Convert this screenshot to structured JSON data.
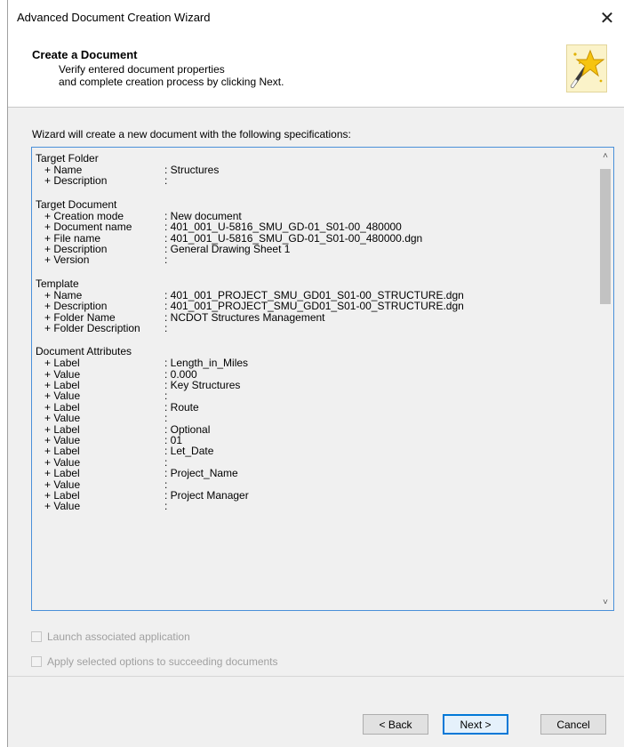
{
  "window": {
    "title": "Advanced Document Creation Wizard",
    "close_glyph": "✕"
  },
  "header": {
    "title": "Create a Document",
    "subtitle": "Verify entered document properties\nand complete creation process by clicking Next.",
    "icon": "magic-wand-star-icon"
  },
  "intro": "Wizard will create a new document with the following specifications:",
  "sections": [
    {
      "heading": "Target Folder",
      "rows": [
        {
          "k": "+ Name",
          "v": ": Structures"
        },
        {
          "k": "+ Description",
          "v": ":"
        }
      ]
    },
    {
      "heading": "Target Document",
      "rows": [
        {
          "k": "+ Creation mode",
          "v": ": New document"
        },
        {
          "k": "+ Document name",
          "v": ": 401_001_U-5816_SMU_GD-01_S01-00_480000"
        },
        {
          "k": "+ File name",
          "v": ": 401_001_U-5816_SMU_GD-01_S01-00_480000.dgn"
        },
        {
          "k": "+ Description",
          "v": ": General Drawing Sheet 1"
        },
        {
          "k": "+ Version",
          "v": ":"
        }
      ]
    },
    {
      "heading": "Template",
      "rows": [
        {
          "k": "+ Name",
          "v": ": 401_001_PROJECT_SMU_GD01_S01-00_STRUCTURE.dgn"
        },
        {
          "k": "+ Description",
          "v": ": 401_001_PROJECT_SMU_GD01_S01-00_STRUCTURE.dgn"
        },
        {
          "k": "+ Folder Name",
          "v": ": NCDOT Structures Management"
        },
        {
          "k": "+ Folder Description",
          "v": ":"
        }
      ]
    },
    {
      "heading": "Document Attributes",
      "rows": [
        {
          "k": "+ Label",
          "v": ": Length_in_Miles"
        },
        {
          "k": "+ Value",
          "v": ": 0.000"
        },
        {
          "k": "+ Label",
          "v": ": Key Structures"
        },
        {
          "k": "+ Value",
          "v": ":"
        },
        {
          "k": "+ Label",
          "v": ": Route"
        },
        {
          "k": "+ Value",
          "v": ":"
        },
        {
          "k": "+ Label",
          "v": ": Optional"
        },
        {
          "k": "+ Value",
          "v": ": 01"
        },
        {
          "k": "+ Label",
          "v": ": Let_Date"
        },
        {
          "k": "+ Value",
          "v": ":"
        },
        {
          "k": "+ Label",
          "v": ": Project_Name"
        },
        {
          "k": "+ Value",
          "v": ":"
        },
        {
          "k": "+ Label",
          "v": ": Project Manager"
        },
        {
          "k": "+ Value",
          "v": ":"
        }
      ]
    }
  ],
  "scroll": {
    "up_glyph": "˄",
    "down_glyph": "˅"
  },
  "options": {
    "launch_label": "Launch associated application",
    "apply_label": "Apply selected options to succeeding documents"
  },
  "buttons": {
    "back": "< Back",
    "next": "Next >",
    "cancel": "Cancel"
  }
}
